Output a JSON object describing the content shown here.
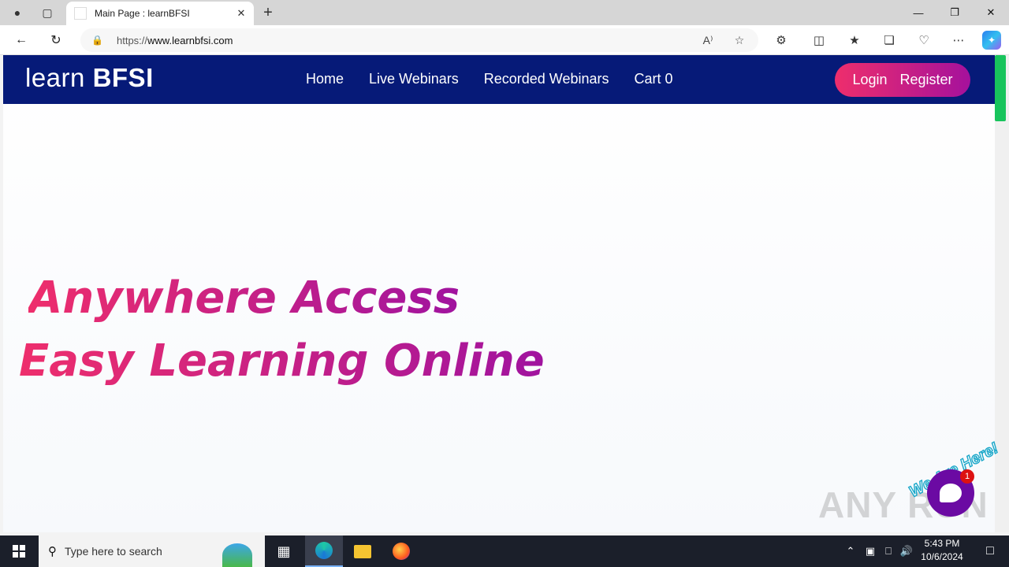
{
  "browser": {
    "tab_title": "Main Page : learnBFSI",
    "url_prefix": "https://",
    "url_host": "www.learnbfsi.com"
  },
  "site": {
    "logo_light": "learn",
    "logo_bold": "BFSI",
    "nav": [
      {
        "label": "Home"
      },
      {
        "label": "Live Webinars"
      },
      {
        "label": "Recorded Webinars"
      },
      {
        "label": "Cart 0"
      }
    ],
    "login_label": "Login",
    "register_label": "Register",
    "hero_line1": "Anywhere Access",
    "hero_line2": "Easy Learning Online",
    "chat_caption": "We Are Here!",
    "chat_badge": "1",
    "colors": {
      "header": "#061a78",
      "accent_start": "#ee2e6c",
      "accent_end": "#a5119c",
      "scroll_thumb": "#18c45c"
    }
  },
  "watermark": "ANY RUN",
  "taskbar": {
    "search_placeholder": "Type here to search",
    "time": "5:43 PM",
    "date": "10/6/2024"
  }
}
